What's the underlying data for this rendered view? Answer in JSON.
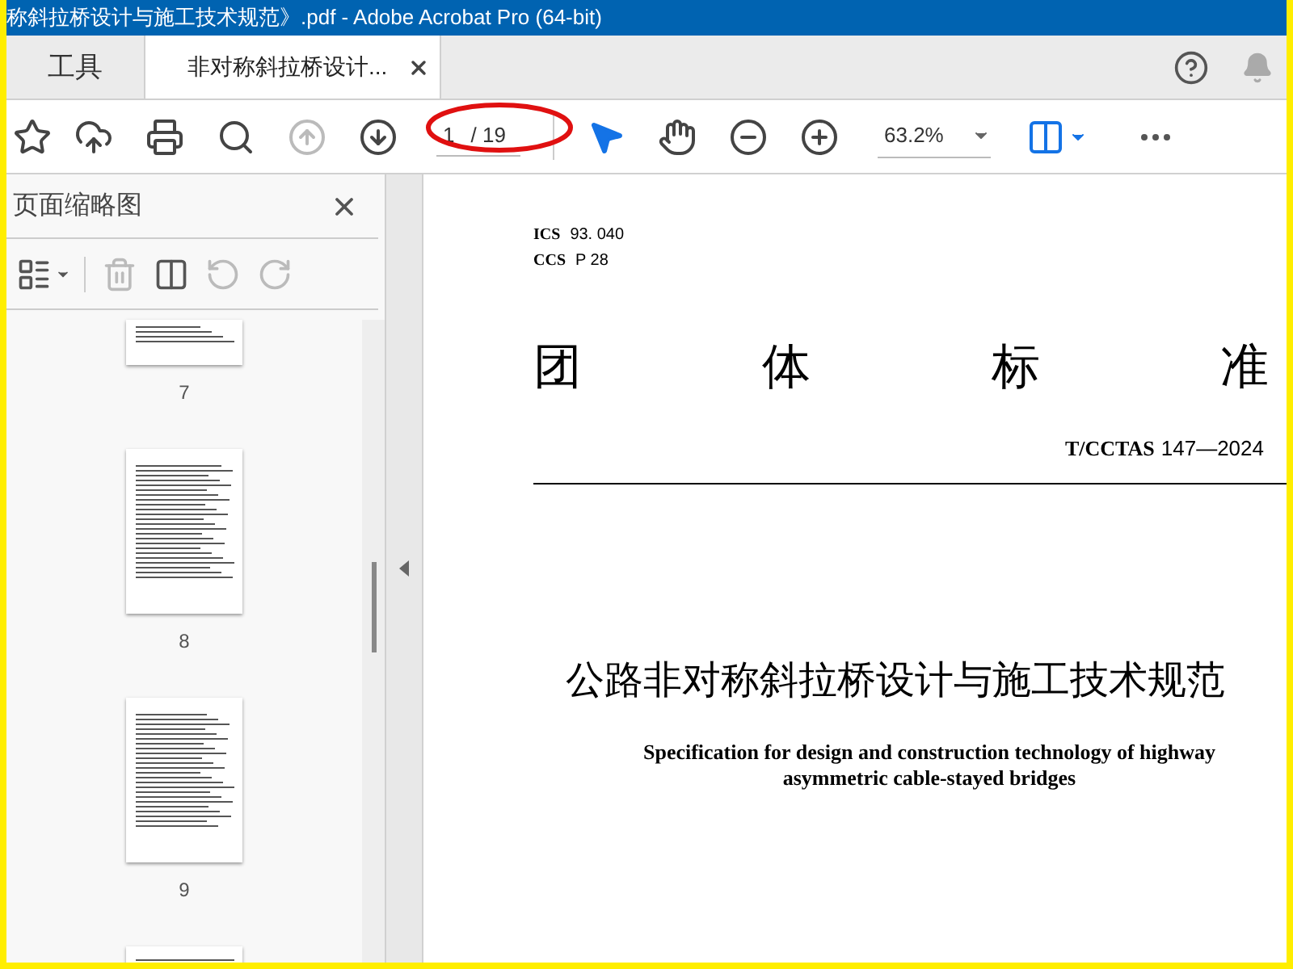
{
  "window": {
    "title": "称斜拉桥设计与施工技术规范》.pdf - Adobe Acrobat Pro (64-bit)"
  },
  "tabs": [
    {
      "label": "工具",
      "selected": false
    },
    {
      "label": "非对称斜拉桥设计...",
      "selected": true
    }
  ],
  "toolbar": {
    "tools": [
      {
        "kind": "bookmark",
        "disabled": false
      },
      {
        "kind": "upload",
        "disabled": false
      },
      {
        "kind": "print",
        "disabled": false
      },
      {
        "kind": "search",
        "disabled": false
      },
      {
        "kind": "previous",
        "disabled": true
      },
      {
        "kind": "next",
        "disabled": false
      }
    ],
    "page_number": "1",
    "page_count": "/ 19",
    "view_tools": [
      {
        "kind": "select",
        "selected": true
      },
      {
        "kind": "hand",
        "selected": false
      }
    ],
    "zoom": "63.2%"
  },
  "sidebar": {
    "title": "页面缩略图",
    "tools": [
      {
        "kind": "delete",
        "disabled": true
      },
      {
        "kind": "insert",
        "disabled": false
      },
      {
        "kind": "rotate-left",
        "disabled": true
      },
      {
        "kind": "rotate-right",
        "disabled": true
      }
    ],
    "thumbnails": [
      {
        "label": "7"
      },
      {
        "label": "8"
      },
      {
        "label": "9"
      }
    ]
  },
  "document": {
    "codes": [
      {
        "label": "ICS",
        "value": "93. 040"
      },
      {
        "label": "CCS",
        "value": "P 28"
      }
    ],
    "heading_chars": [
      "团",
      "体",
      "标",
      "准"
    ],
    "standard_label": "T/CCTAS",
    "standard_number": "147—2024",
    "title": "公路非对称斜拉桥设计与施工技术规范",
    "subtitle_lines": [
      "Specification for design and construction technology of highway",
      "asymmetric cable-stayed bridges"
    ]
  }
}
